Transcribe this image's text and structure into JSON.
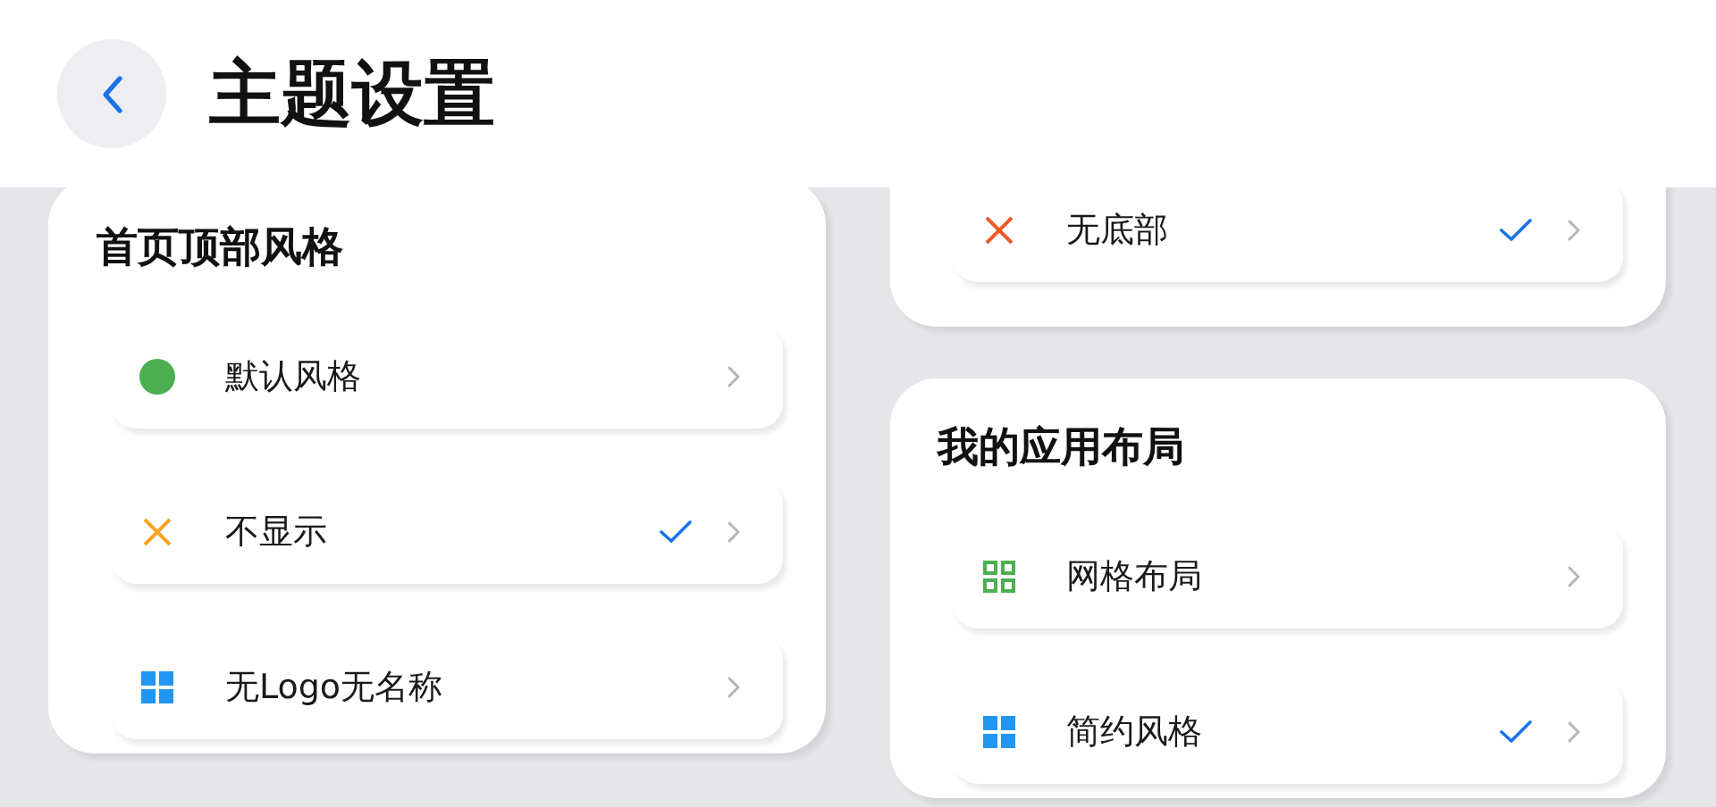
{
  "header": {
    "title": "主题设置"
  },
  "sections": [
    {
      "title": "首页顶部风格",
      "items": [
        {
          "label": "默认风格",
          "kind": "dot",
          "color": "#4caf50",
          "selected": false
        },
        {
          "label": "不显示",
          "kind": "cross",
          "color": "#f5a623",
          "selected": true
        },
        {
          "label": "无Logo无名称",
          "kind": "tiles",
          "color": "#2196f3",
          "selected": false
        }
      ]
    },
    {
      "items": [
        {
          "label": "无底部",
          "kind": "cross",
          "color": "#f05a28",
          "selected": true
        }
      ]
    },
    {
      "title": "我的应用布局",
      "items": [
        {
          "label": "网格布局",
          "kind": "outline-grid",
          "color": "#4caf50",
          "selected": false
        },
        {
          "label": "简约风格",
          "kind": "tiles",
          "color": "#2196f3",
          "selected": true
        }
      ]
    }
  ]
}
